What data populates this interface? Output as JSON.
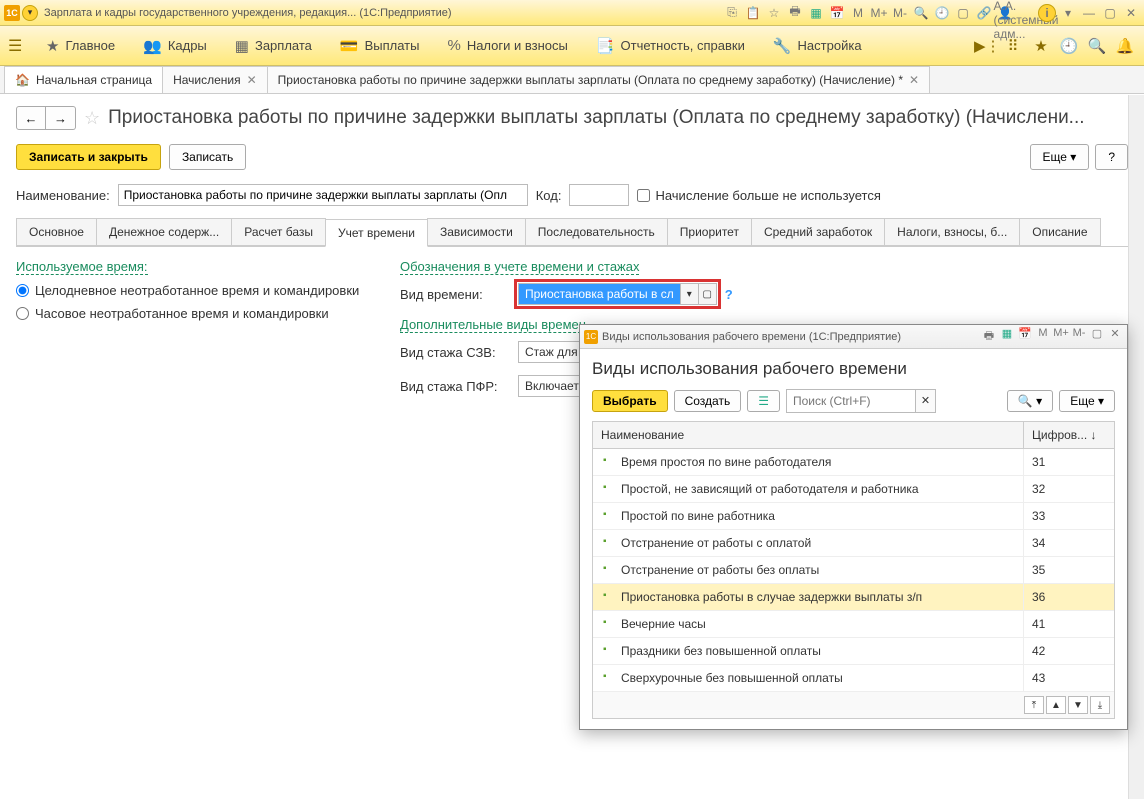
{
  "titlebar": {
    "app_title": "Зарплата и кадры государственного учреждения, редакция...   (1С:Предприятие)",
    "user": "Григорьянц А.А. (системный адм...",
    "m_labels": [
      "M",
      "M+",
      "M-"
    ]
  },
  "mainmenu": {
    "items": [
      {
        "icon": "★",
        "label": "Главное"
      },
      {
        "icon": "👥",
        "label": "Кадры"
      },
      {
        "icon": "▦",
        "label": "Зарплата"
      },
      {
        "icon": "💳",
        "label": "Выплаты"
      },
      {
        "icon": "%",
        "label": "Налоги и взносы"
      },
      {
        "icon": "📑",
        "label": "Отчетность, справки"
      },
      {
        "icon": "🔧",
        "label": "Настройка"
      }
    ]
  },
  "tabs": {
    "home": "Начальная страница",
    "t1": "Начисления",
    "t2": "Приостановка работы по причине задержки выплаты зарплаты (Оплата по среднему заработку) (Начисление) *"
  },
  "page": {
    "title": "Приостановка работы по причине задержки выплаты зарплаты (Оплата по среднему заработку) (Начислени...",
    "save_close": "Записать и закрыть",
    "save": "Записать",
    "more": "Еще",
    "help": "?"
  },
  "form": {
    "name_label": "Наименование:",
    "name_value": "Приостановка работы по причине задержки выплаты зарплаты (Опл",
    "code_label": "Код:",
    "code_value": "",
    "not_used": "Начисление больше не используется"
  },
  "subtabs": [
    "Основное",
    "Денежное содерж...",
    "Расчет базы",
    "Учет времени",
    "Зависимости",
    "Последовательность",
    "Приоритет",
    "Средний заработок",
    "Налоги, взносы, б...",
    "Описание"
  ],
  "subtabs_active": 3,
  "left": {
    "heading": "Используемое время:",
    "r1": "Целодневное неотработанное время и командировки",
    "r2": "Часовое неотработанное время и командировки"
  },
  "right": {
    "heading1": "Обозначения в учете времени и стажах",
    "vid_vremeni_label": "Вид времени:",
    "vid_vremeni_value": "Приостановка работы в сл",
    "heading2": "Дополнительные виды времен",
    "szv_label": "Вид стажа СЗВ:",
    "szv_value": "Стаж для до",
    "pfr_label": "Вид стажа ПФР:",
    "pfr_value": "Включается"
  },
  "popup": {
    "wintitle": "Виды использования рабочего времени (1С:Предприятие)",
    "heading": "Виды использования рабочего времени",
    "select": "Выбрать",
    "create": "Создать",
    "search_placeholder": "Поиск (Ctrl+F)",
    "more": "Еще",
    "col1": "Наименование",
    "col2": "Цифров...",
    "rows": [
      {
        "name": "Время простоя по вине работодателя",
        "code": "31"
      },
      {
        "name": "Простой, не зависящий от работодателя и работника",
        "code": "32"
      },
      {
        "name": "Простой по вине работника",
        "code": "33"
      },
      {
        "name": "Отстранение от работы с оплатой",
        "code": "34"
      },
      {
        "name": "Отстранение от работы без оплаты",
        "code": "35"
      },
      {
        "name": "Приостановка работы в случае задержки выплаты з/п",
        "code": "36"
      },
      {
        "name": "Вечерние часы",
        "code": "41"
      },
      {
        "name": "Праздники без повышенной оплаты",
        "code": "42"
      },
      {
        "name": "Сверхурочные без повышенной оплаты",
        "code": "43"
      }
    ],
    "selected_index": 5
  }
}
